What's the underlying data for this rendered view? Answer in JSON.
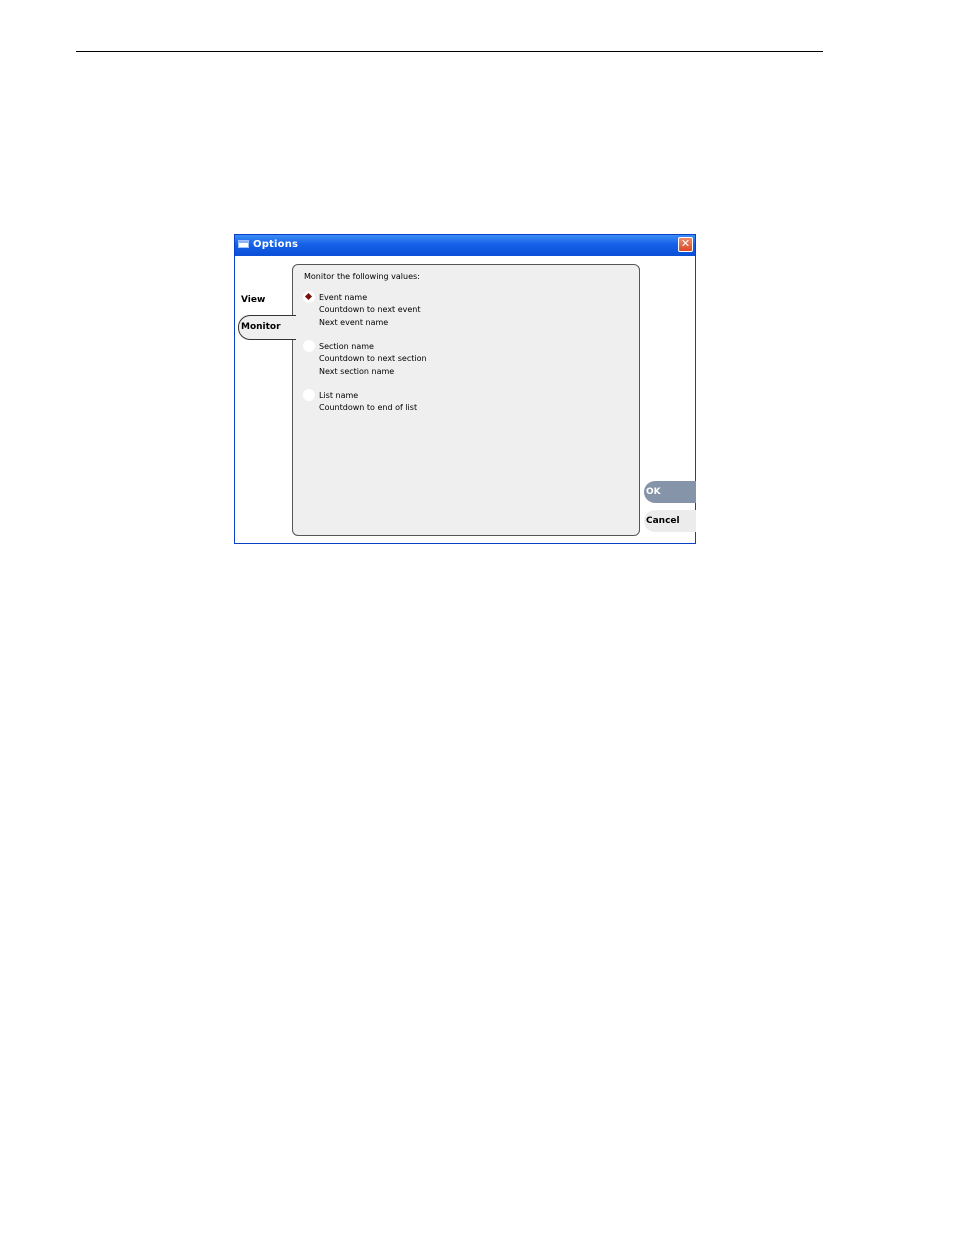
{
  "window": {
    "title": "Options",
    "close_label": "✕"
  },
  "tabs": [
    {
      "label": "View"
    },
    {
      "label": "Monitor",
      "selected": true
    }
  ],
  "panel": {
    "caption": "Monitor the following values:",
    "groups": [
      {
        "selected": true,
        "lines": [
          "Event name",
          "Countdown to next event",
          "Next event name"
        ]
      },
      {
        "selected": false,
        "lines": [
          "Section name",
          "Countdown to next section",
          "Next section name"
        ]
      },
      {
        "selected": false,
        "lines": [
          "List name",
          "Countdown to end of list"
        ]
      }
    ]
  },
  "buttons": {
    "ok": "OK",
    "cancel": "Cancel"
  },
  "colors": {
    "titlebar": "#1560e8",
    "ok_button": "#8594a9",
    "radio_selected": "#7a0f0f"
  }
}
